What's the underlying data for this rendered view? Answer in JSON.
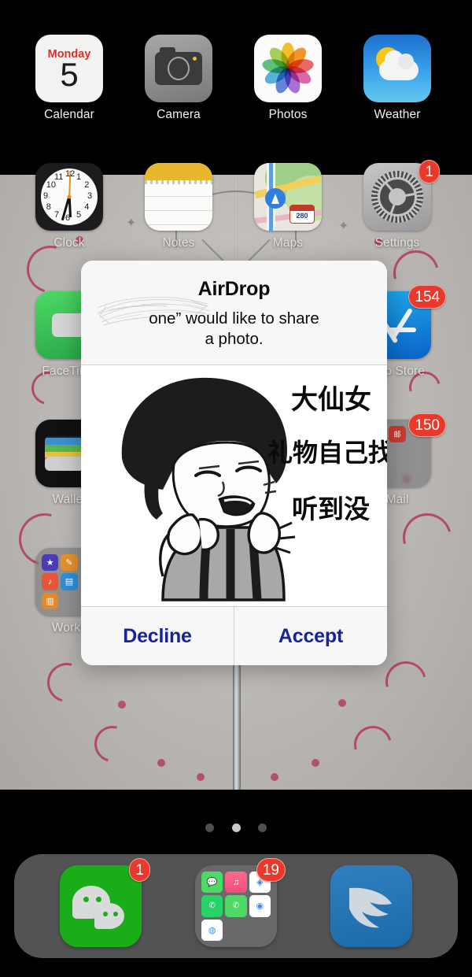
{
  "device": {
    "platform": "iOS home screen",
    "page_dots": {
      "count": 3,
      "active_index": 1
    }
  },
  "home_screen": {
    "row1": [
      {
        "name": "Calendar",
        "label": "Calendar",
        "icon": "calendar-icon",
        "calendar": {
          "weekday": "Monday",
          "day": "5"
        },
        "badge": null
      },
      {
        "name": "Camera",
        "label": "Camera",
        "icon": "camera-icon",
        "badge": null
      },
      {
        "name": "Photos",
        "label": "Photos",
        "icon": "photos-icon",
        "badge": null
      },
      {
        "name": "Weather",
        "label": "Weather",
        "icon": "weather-icon",
        "badge": null
      }
    ],
    "row2": [
      {
        "name": "Clock",
        "label": "Clock",
        "icon": "clock-icon",
        "badge": null
      },
      {
        "name": "Notes",
        "label": "Notes",
        "icon": "notes-icon",
        "badge": null
      },
      {
        "name": "Maps",
        "label": "Maps",
        "icon": "maps-icon",
        "route_shield": "280",
        "badge": null
      },
      {
        "name": "Settings",
        "label": "Settings",
        "icon": "settings-gear-icon",
        "badge": "1"
      }
    ],
    "row3": [
      {
        "name": "FaceTime",
        "label": "FaceTime",
        "icon": "facetime-icon",
        "badge": null
      },
      {
        "name": "AppStore",
        "label": "App Store",
        "icon": "app-store-icon",
        "badge": "154"
      }
    ],
    "row4": [
      {
        "name": "Wallet",
        "label": "Wallet",
        "icon": "wallet-icon",
        "badge": null
      },
      {
        "name": "MailFolder",
        "label": "Mail",
        "icon": "folder-icon",
        "badge": "150"
      }
    ],
    "row5": [
      {
        "name": "WorksFolder",
        "label": "Works",
        "icon": "folder-icon",
        "badge": null
      }
    ]
  },
  "dock": {
    "items": [
      {
        "name": "WeChat",
        "icon": "wechat-icon",
        "badge": "1"
      },
      {
        "name": "Folder",
        "icon": "folder-icon",
        "badge": "19",
        "contents": [
          "Messages",
          "Music",
          "Safari",
          "WhatsApp",
          "Phone",
          "Chrome",
          "QQ"
        ]
      },
      {
        "name": "DingTalk",
        "icon": "dingtalk-icon",
        "badge": null
      }
    ]
  },
  "airdrop_dialog": {
    "title": "AirDrop",
    "message_line1": "one” would like to share",
    "message_line2": "a photo.",
    "redaction": "scribble-redaction",
    "decline_label": "Decline",
    "accept_label": "Accept",
    "accent_color": "#16239b",
    "preview": {
      "type": "meme-image",
      "text_lines": [
        "大仙女",
        "礼物自己找",
        "听到没"
      ]
    }
  }
}
